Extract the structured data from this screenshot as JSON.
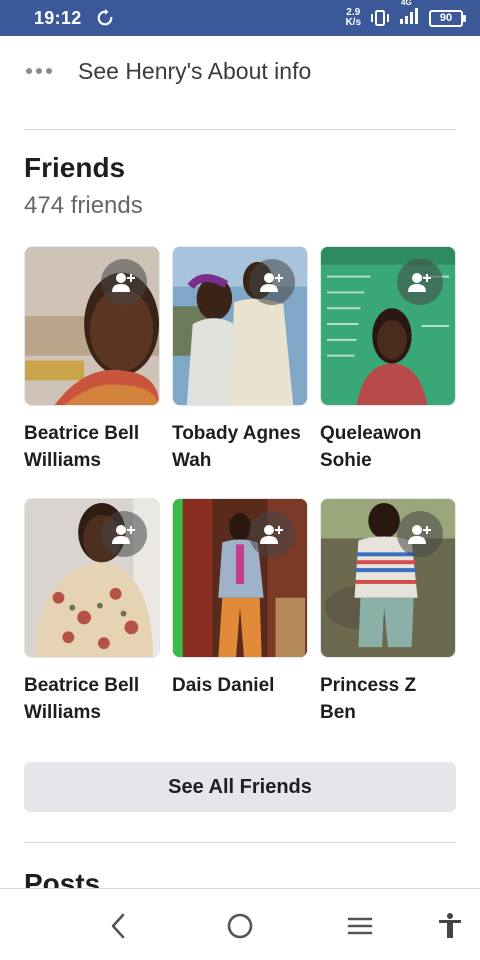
{
  "status_bar": {
    "time": "19:12",
    "net_speed_value": "2.9",
    "net_speed_unit": "K/s",
    "network_type": "4G",
    "battery_level": "90",
    "bg_color": "#3b5998"
  },
  "about": {
    "label": "See Henry's About info",
    "icon": "more-dots-icon"
  },
  "friends": {
    "title": "Friends",
    "count_text": "474 friends",
    "items": [
      {
        "name": "Beatrice Bell Williams"
      },
      {
        "name": "Tobady Agnes Wah"
      },
      {
        "name": "Queleawon Sohie"
      },
      {
        "name": "Beatrice Bell Williams"
      },
      {
        "name": "Dais Daniel"
      },
      {
        "name": "Princess Z Ben"
      }
    ],
    "add_friend_icon": "add-friend-icon",
    "see_all_label": "See All Friends"
  },
  "posts": {
    "title": "Posts"
  },
  "nav_bar": {
    "icons": [
      "back-icon",
      "home-icon",
      "recents-icon",
      "accessibility-icon"
    ]
  }
}
